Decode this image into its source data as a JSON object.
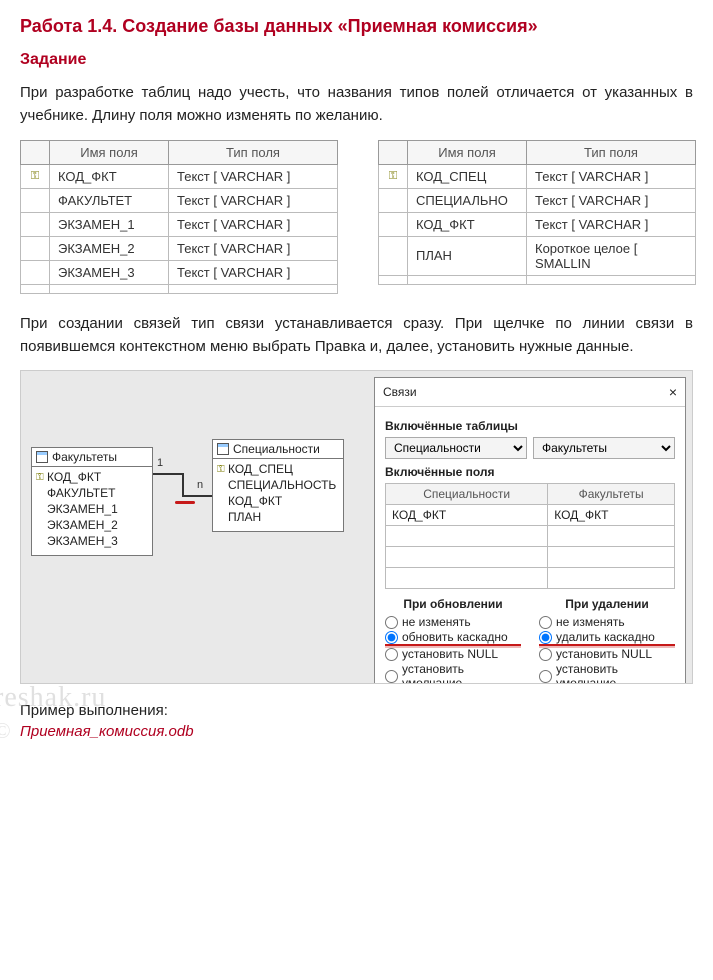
{
  "title": "Работа 1.4. Создание базы данных «Приемная комиссия»",
  "subtitle": "Задание",
  "para1": "При разработке таблиц надо учесть, что названия типов полей отличается от указанных в учебнике. Длину поля можно изменять по желанию.",
  "para2": "При создании связей тип связи устанавливается сразу. При щелчке по линии связи в появившемся контекстном меню выбрать Правка и, далее, установить нужные данные.",
  "table_header_name": "Имя поля",
  "table_header_type": "Тип поля",
  "table1": {
    "rows": [
      {
        "key": "⚿",
        "name": "КОД_ФКТ",
        "type": "Текст [ VARCHAR ]"
      },
      {
        "key": "",
        "name": "ФАКУЛЬТЕТ",
        "type": "Текст [ VARCHAR ]"
      },
      {
        "key": "",
        "name": "ЭКЗАМЕН_1",
        "type": "Текст [ VARCHAR ]"
      },
      {
        "key": "",
        "name": "ЭКЗАМЕН_2",
        "type": "Текст [ VARCHAR ]"
      },
      {
        "key": "",
        "name": "ЭКЗАМЕН_3",
        "type": "Текст [ VARCHAR ]"
      }
    ]
  },
  "table2": {
    "rows": [
      {
        "key": "⚿",
        "name": "КОД_СПЕЦ",
        "type": "Текст [ VARCHAR ]"
      },
      {
        "key": "",
        "name": "СПЕЦИАЛЬНО",
        "type": "Текст [ VARCHAR ]"
      },
      {
        "key": "",
        "name": "КОД_ФКТ",
        "type": "Текст [ VARCHAR ]"
      },
      {
        "key": "",
        "name": "ПЛАН",
        "type": "Короткое целое [ SMALLIN"
      }
    ]
  },
  "entity1": {
    "title": "Факультеты",
    "fields": [
      {
        "key": "⚿",
        "label": "КОД_ФКТ"
      },
      {
        "key": "",
        "label": "ФАКУЛЬТЕТ"
      },
      {
        "key": "",
        "label": "ЭКЗАМЕН_1"
      },
      {
        "key": "",
        "label": "ЭКЗАМЕН_2"
      },
      {
        "key": "",
        "label": "ЭКЗАМЕН_3"
      }
    ]
  },
  "entity2": {
    "title": "Специальности",
    "fields": [
      {
        "key": "⚿",
        "label": "КОД_СПЕЦ"
      },
      {
        "key": "",
        "label": "СПЕЦИАЛЬНОСТЬ"
      },
      {
        "key": "",
        "label": "КОД_ФКТ"
      },
      {
        "key": "",
        "label": "ПЛАН"
      }
    ]
  },
  "rel_left": "1",
  "rel_right": "n",
  "dialog": {
    "title": "Связи",
    "section_tables": "Включённые таблицы",
    "combo1": "Специальности",
    "combo2": "Факультеты",
    "section_fields": "Включённые поля",
    "col1": "Специальности",
    "col2": "Факультеты",
    "row1a": "КОД_ФКТ",
    "row1b": "КОД_ФКТ",
    "on_update": "При обновлении",
    "on_delete": "При удалении",
    "opt_no_change": "не изменять",
    "opt_update_cascade": "обновить каскадно",
    "opt_delete_cascade": "удалить каскадно",
    "opt_set_null": "установить NULL",
    "opt_set_default": "установить умолчание"
  },
  "example_label": "Пример выполнения:",
  "file_link": "Приемная_комиссия.odb",
  "watermark": "reshak.ru",
  "watermark_c": "©"
}
